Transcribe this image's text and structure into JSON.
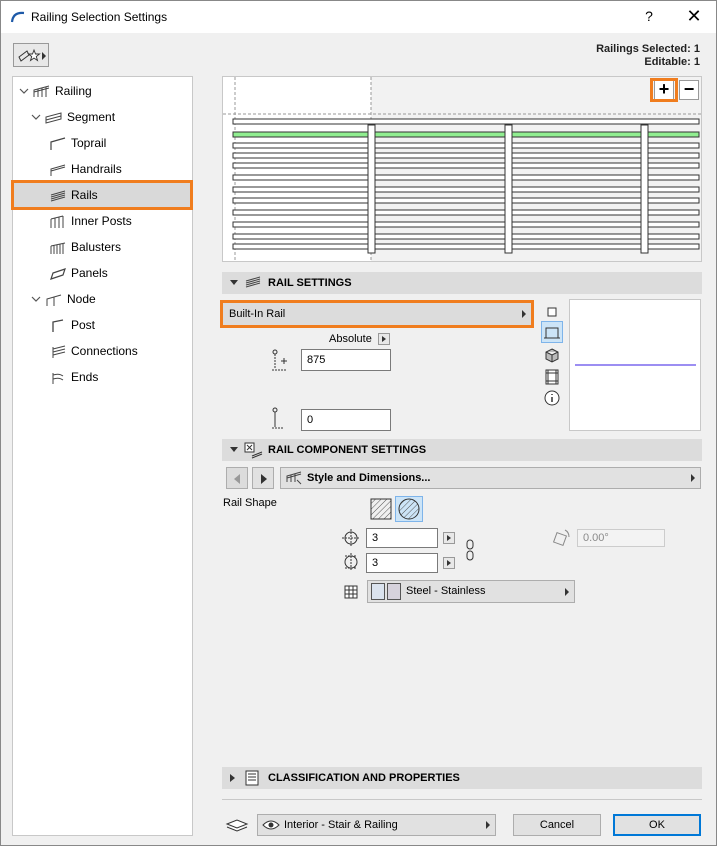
{
  "window": {
    "title": "Railing Selection Settings",
    "help": "?",
    "close": "✕"
  },
  "selection": {
    "selected": "Railings Selected: 1",
    "editable": "Editable: 1"
  },
  "tree": {
    "items": [
      {
        "label": "Railing"
      },
      {
        "label": "Segment"
      },
      {
        "label": "Toprail"
      },
      {
        "label": "Handrails"
      },
      {
        "label": "Rails"
      },
      {
        "label": "Inner Posts"
      },
      {
        "label": "Balusters"
      },
      {
        "label": "Panels"
      },
      {
        "label": "Node"
      },
      {
        "label": "Post"
      },
      {
        "label": "Connections"
      },
      {
        "label": "Ends"
      }
    ],
    "selected": "Rails"
  },
  "preview": {
    "zoom_in": "+",
    "zoom_out": "−"
  },
  "rail_settings": {
    "header": "RAIL SETTINGS",
    "rail_type": "Built-In Rail",
    "elevation_mode": "Absolute",
    "height_value": "875",
    "offset_value": "0"
  },
  "component_settings": {
    "header": "RAIL COMPONENT SETTINGS",
    "panel": "Style and Dimensions...",
    "rail_shape_label": "Rail Shape",
    "width_value": "3",
    "height_value": "3",
    "angle_value": "0.00°",
    "material": "Steel - Stainless"
  },
  "classification": {
    "header": "CLASSIFICATION AND PROPERTIES"
  },
  "footer": {
    "layer": "Interior - Stair & Railing",
    "cancel": "Cancel",
    "ok": "OK"
  },
  "colors": {
    "accent_highlight": "#f07d1e",
    "rail_highlight": "#90ee90",
    "rail_line": "#7b68ee"
  }
}
